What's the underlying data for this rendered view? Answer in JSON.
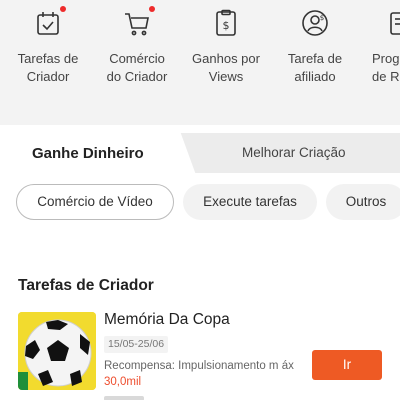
{
  "top_nav": {
    "items": [
      {
        "label": "Tarefas de\nCriador",
        "icon": "calendar-check-icon",
        "dot": true
      },
      {
        "label": "Comércio\ndo Criador",
        "icon": "shopping-cart-icon",
        "dot": true
      },
      {
        "label": "Ganhos por\nViews",
        "icon": "money-clipboard-icon",
        "dot": false
      },
      {
        "label": "Tarefa de\nafiliado",
        "icon": "affiliate-user-icon",
        "dot": false
      },
      {
        "label": "Prog\nde Re",
        "icon": "program-icon",
        "dot": false
      }
    ]
  },
  "tabs": {
    "active": "Ganhe Dinheiro",
    "inactive": "Melhorar Criação"
  },
  "filters": [
    "Comércio de Vídeo",
    "Execute tarefas",
    "Outros"
  ],
  "section": {
    "title": "Tarefas de Criador"
  },
  "task": {
    "title": "Memória Da Copa",
    "dates": "15/05-25/06",
    "reward_prefix": "Recompensa: Impulsionamento m áx ",
    "reward_amount": "30,0mil",
    "button": "Ir"
  },
  "colors": {
    "accent": "#ee5a24",
    "notification_dot": "#ee2b2b",
    "reward_amount": "#ee4d2d"
  }
}
